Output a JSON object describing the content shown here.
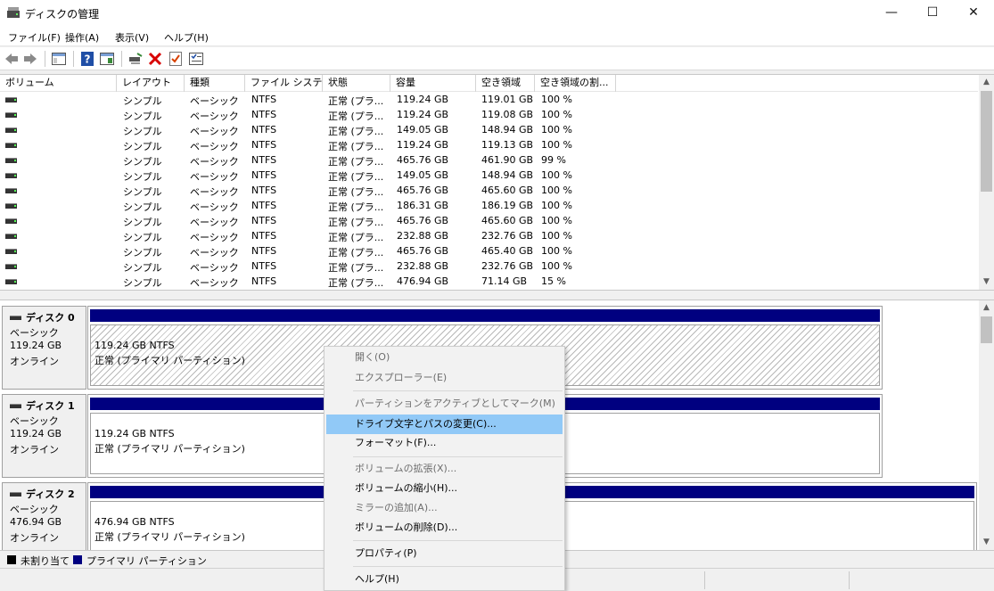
{
  "window": {
    "title": "ディスクの管理",
    "minimize": "—",
    "maximize": "☐",
    "close": "✕"
  },
  "menu": [
    "ファイル(F)",
    "操作(A)",
    "表示(V)",
    "ヘルプ(H)"
  ],
  "toolbar": {
    "icons": [
      "back-arrow-icon",
      "forward-arrow-icon",
      "console-tree-icon",
      "help-icon",
      "details-pane-icon",
      "connect-icon",
      "delete-icon",
      "check-icon",
      "properties-icon"
    ],
    "delete_color": "#d80000",
    "help_color": "#1f4ea6"
  },
  "volume_list": {
    "columns": [
      "ボリューム",
      "レイアウト",
      "種類",
      "ファイル システム",
      "状態",
      "容量",
      "空き領域",
      "空き領域の割..."
    ],
    "rows": [
      [
        "",
        "シンプル",
        "ベーシック",
        "NTFS",
        "正常 (プラ...",
        "119.24 GB",
        "119.01 GB",
        "100 %"
      ],
      [
        "",
        "シンプル",
        "ベーシック",
        "NTFS",
        "正常 (プラ...",
        "119.24 GB",
        "119.08 GB",
        "100 %"
      ],
      [
        "",
        "シンプル",
        "ベーシック",
        "NTFS",
        "正常 (プラ...",
        "149.05 GB",
        "148.94 GB",
        "100 %"
      ],
      [
        "",
        "シンプル",
        "ベーシック",
        "NTFS",
        "正常 (プラ...",
        "119.24 GB",
        "119.13 GB",
        "100 %"
      ],
      [
        "",
        "シンプル",
        "ベーシック",
        "NTFS",
        "正常 (プラ...",
        "465.76 GB",
        "461.90 GB",
        "99 %"
      ],
      [
        "",
        "シンプル",
        "ベーシック",
        "NTFS",
        "正常 (プラ...",
        "149.05 GB",
        "148.94 GB",
        "100 %"
      ],
      [
        "",
        "シンプル",
        "ベーシック",
        "NTFS",
        "正常 (プラ...",
        "465.76 GB",
        "465.60 GB",
        "100 %"
      ],
      [
        "",
        "シンプル",
        "ベーシック",
        "NTFS",
        "正常 (プラ...",
        "186.31 GB",
        "186.19 GB",
        "100 %"
      ],
      [
        "",
        "シンプル",
        "ベーシック",
        "NTFS",
        "正常 (プラ...",
        "465.76 GB",
        "465.60 GB",
        "100 %"
      ],
      [
        "",
        "シンプル",
        "ベーシック",
        "NTFS",
        "正常 (プラ...",
        "232.88 GB",
        "232.76 GB",
        "100 %"
      ],
      [
        "",
        "シンプル",
        "ベーシック",
        "NTFS",
        "正常 (プラ...",
        "465.76 GB",
        "465.40 GB",
        "100 %"
      ],
      [
        "",
        "シンプル",
        "ベーシック",
        "NTFS",
        "正常 (プラ...",
        "232.88 GB",
        "232.76 GB",
        "100 %"
      ],
      [
        "",
        "シンプル",
        "ベーシック",
        "NTFS",
        "正常 (プラ...",
        "476.94 GB",
        "71.14 GB",
        "15 %"
      ]
    ]
  },
  "disks": [
    {
      "name": "ディスク 0",
      "type": "ベーシック",
      "size": "119.24 GB",
      "status": "オンライン",
      "partition_line1": "119.24 GB NTFS",
      "partition_line2": "正常 (プライマリ パーティション)"
    },
    {
      "name": "ディスク 1",
      "type": "ベーシック",
      "size": "119.24 GB",
      "status": "オンライン",
      "partition_line1": "119.24 GB NTFS",
      "partition_line2": "正常 (プライマリ パーティション)"
    },
    {
      "name": "ディスク 2",
      "type": "ベーシック",
      "size": "476.94 GB",
      "status": "オンライン",
      "partition_line1": "476.94 GB NTFS",
      "partition_line2": "正常 (プライマリ パーティション)"
    }
  ],
  "legend": {
    "unallocated": "未割り当て",
    "primary": "プライマリ パーティション",
    "unallocated_color": "#000000",
    "primary_color": "#000080"
  },
  "context_menu": {
    "items": [
      {
        "label": "開く(O)",
        "disabled": true
      },
      {
        "label": "エクスプローラー(E)",
        "disabled": true
      },
      {
        "label": "パーティションをアクティブとしてマーク(M)",
        "disabled": true
      },
      {
        "label": "ドライブ文字とパスの変更(C)...",
        "disabled": false,
        "highlighted": true
      },
      {
        "label": "フォーマット(F)...",
        "disabled": false
      },
      {
        "label": "ボリュームの拡張(X)...",
        "disabled": true
      },
      {
        "label": "ボリュームの縮小(H)...",
        "disabled": false
      },
      {
        "label": "ミラーの追加(A)...",
        "disabled": true
      },
      {
        "label": "ボリュームの削除(D)...",
        "disabled": false
      },
      {
        "label": "プロパティ(P)",
        "disabled": false
      },
      {
        "label": "ヘルプ(H)",
        "disabled": false
      }
    ],
    "highlight_color": "#91c9f7"
  }
}
